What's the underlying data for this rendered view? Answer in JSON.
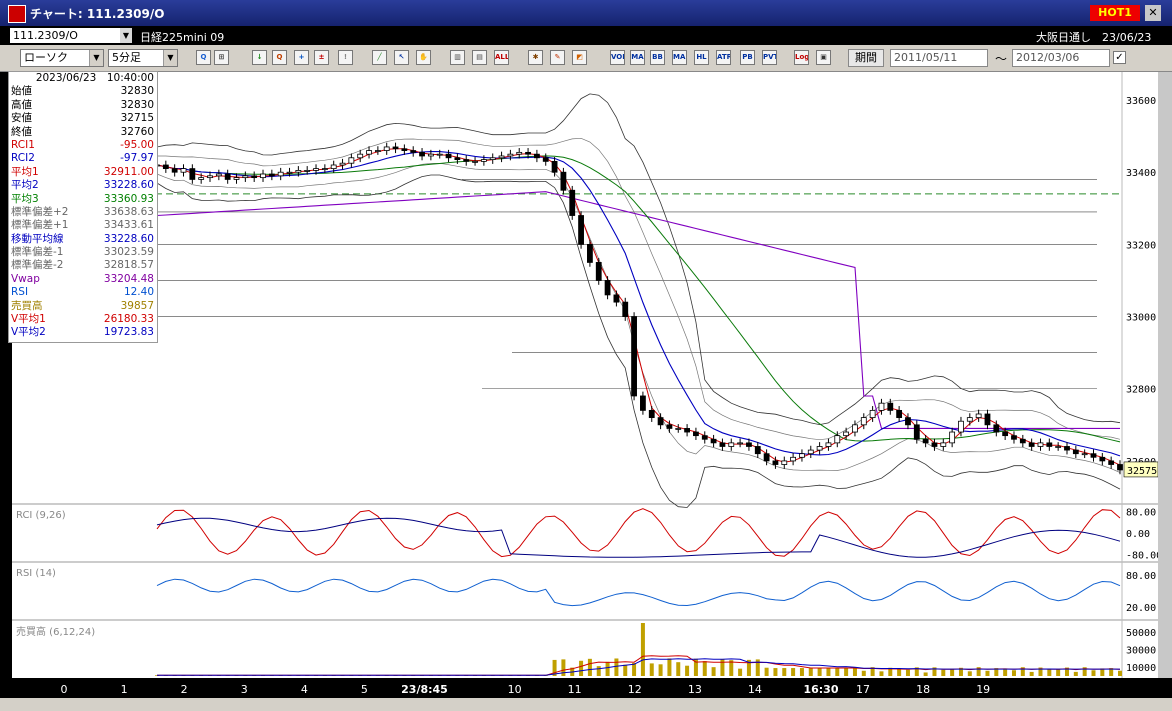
{
  "window": {
    "title": "チャート: 111.2309/O",
    "hot_label": "HOT1",
    "close_label": "✕"
  },
  "symbol_bar": {
    "symbol": "111.2309/O",
    "instrument_name": "日経225mini 09",
    "market_info": "大阪日通し　23/06/23"
  },
  "toolbar": {
    "chart_type": "ローソク",
    "interval": "5分足",
    "icon_buttons": [
      {
        "name": "zoom-icon",
        "label": "Q",
        "color": "#1a5fd0"
      },
      {
        "name": "grid-icon",
        "label": "⊞",
        "color": "#444"
      },
      {
        "name": "arrow-down-icon",
        "label": "↓",
        "color": "#1a8a1a"
      },
      {
        "name": "magnify-icon",
        "label": "Q",
        "color": "#c04000"
      },
      {
        "name": "crosshair-icon",
        "label": "+",
        "color": "#0050c0"
      },
      {
        "name": "compare-icon",
        "label": "±",
        "color": "#c00000"
      },
      {
        "name": "warning-icon",
        "label": "!",
        "color": "#888"
      },
      {
        "name": "trendline-icon",
        "label": "╱",
        "color": "#2a8a2a"
      },
      {
        "name": "pointer-icon",
        "label": "↖",
        "color": "#0030a0"
      },
      {
        "name": "hand-icon",
        "label": "✋",
        "color": "#0060c0"
      },
      {
        "name": "bars-icon",
        "label": "▥",
        "color": "#444"
      },
      {
        "name": "bars2-icon",
        "label": "▤",
        "color": "#444"
      },
      {
        "name": "all-icon",
        "label": "ALL",
        "color": "#c00000"
      },
      {
        "name": "settings-icon",
        "label": "✱",
        "color": "#804000"
      },
      {
        "name": "brush-icon",
        "label": "✎",
        "color": "#c03000"
      },
      {
        "name": "color-icon",
        "label": "◩",
        "color": "#d06000"
      },
      {
        "name": "volume-icon",
        "label": "VOL",
        "color": "#0030a0"
      },
      {
        "name": "ma-icon",
        "label": "MA",
        "color": "#0030a0"
      },
      {
        "name": "bb-icon",
        "label": "BB",
        "color": "#0030a0"
      },
      {
        "name": "mae-icon",
        "label": "MAE",
        "color": "#0030a0"
      },
      {
        "name": "hl-icon",
        "label": "HL",
        "color": "#0030a0"
      },
      {
        "name": "atr-icon",
        "label": "ATR",
        "color": "#0030a0"
      },
      {
        "name": "pb-icon",
        "label": "PB",
        "color": "#0030a0"
      },
      {
        "name": "pvt-icon",
        "label": "PVT",
        "color": "#0030a0"
      },
      {
        "name": "log-icon",
        "label": "Log",
        "color": "#c00000"
      },
      {
        "name": "print-icon",
        "label": "▣",
        "color": "#333"
      }
    ],
    "period_label": "期間",
    "date_from": "2011/05/11",
    "date_to": "2012/03/06",
    "tilde": "～",
    "check": "✓"
  },
  "info_panel": {
    "datetime": "2023/06/23　10:40:00",
    "rows": [
      {
        "label": "始値",
        "value": "32830",
        "color": "#000000"
      },
      {
        "label": "高値",
        "value": "32830",
        "color": "#000000"
      },
      {
        "label": "安値",
        "value": "32715",
        "color": "#000000"
      },
      {
        "label": "終値",
        "value": "32760",
        "color": "#000000"
      },
      {
        "label": "RCI1",
        "value": "-95.00",
        "color": "#d00000"
      },
      {
        "label": "RCI2",
        "value": "-97.97",
        "color": "#0000c0"
      },
      {
        "label": "平均1",
        "value": "32911.00",
        "color": "#d00000"
      },
      {
        "label": "平均2",
        "value": "33228.60",
        "color": "#0000c0"
      },
      {
        "label": "平均3",
        "value": "33360.93",
        "color": "#008000"
      },
      {
        "label": "標準偏差+2",
        "value": "33638.63",
        "color": "#666666"
      },
      {
        "label": "標準偏差+1",
        "value": "33433.61",
        "color": "#666666"
      },
      {
        "label": "移動平均線",
        "value": "33228.60",
        "color": "#0000c0"
      },
      {
        "label": "標準偏差-1",
        "value": "33023.59",
        "color": "#666666"
      },
      {
        "label": "標準偏差-2",
        "value": "32818.57",
        "color": "#666666"
      },
      {
        "label": "Vwap",
        "value": "33204.48",
        "color": "#8000a0"
      },
      {
        "label": "RSI",
        "value": "12.40",
        "color": "#0050d0"
      },
      {
        "label": "売買高",
        "value": "39857",
        "color": "#a08000"
      },
      {
        "label": "V平均1",
        "value": "26180.33",
        "color": "#d00000"
      },
      {
        "label": "V平均2",
        "value": "19723.83",
        "color": "#0000c0"
      }
    ]
  },
  "chart_data": {
    "type": "candlestick",
    "price_axis": {
      "min": 32500,
      "max": 33650,
      "ticks": [
        "33600",
        "33400",
        "33200",
        "33000",
        "32800",
        "32600"
      ],
      "last_price": "32575"
    },
    "reference_line": 33340,
    "x_ticks": [
      {
        "label": "0",
        "idx": 3
      },
      {
        "label": "1",
        "idx": 13
      },
      {
        "label": "2",
        "idx": 23
      },
      {
        "label": "3",
        "idx": 33
      },
      {
        "label": "4",
        "idx": 43
      },
      {
        "label": "5",
        "idx": 53
      },
      {
        "label": "23/8:45",
        "idx": 63,
        "bold": true
      },
      {
        "label": "10",
        "idx": 78
      },
      {
        "label": "11",
        "idx": 88
      },
      {
        "label": "12",
        "idx": 98
      },
      {
        "label": "13",
        "idx": 108
      },
      {
        "label": "14",
        "idx": 118
      },
      {
        "label": "16:30",
        "idx": 129,
        "bold": true
      },
      {
        "label": "17",
        "idx": 136
      },
      {
        "label": "18",
        "idx": 146
      },
      {
        "label": "19",
        "idx": 156
      }
    ],
    "closes": [
      33420,
      33410,
      33400,
      33410,
      33380,
      33385,
      33390,
      33395,
      33380,
      33385,
      33390,
      33385,
      33395,
      33390,
      33400,
      33400,
      33405,
      33405,
      33410,
      33410,
      33420,
      33425,
      33440,
      33450,
      33460,
      33460,
      33470,
      33465,
      33460,
      33455,
      33445,
      33450,
      33450,
      33440,
      33435,
      33430,
      33430,
      33435,
      33440,
      33445,
      33450,
      33455,
      33450,
      33440,
      33430,
      33400,
      33350,
      33280,
      33200,
      33150,
      33100,
      33060,
      33040,
      33000,
      32780,
      32740,
      32720,
      32700,
      32690,
      32690,
      32680,
      32670,
      32660,
      32650,
      32640,
      32650,
      32650,
      32640,
      32620,
      32600,
      32590,
      32600,
      32610,
      32620,
      32630,
      32640,
      32650,
      32670,
      32680,
      32700,
      32720,
      32740,
      32760,
      32740,
      32720,
      32700,
      32660,
      32650,
      32640,
      32650,
      32680,
      32710,
      32720,
      32730,
      32700,
      32680,
      32670,
      32660,
      32650,
      32640,
      32650,
      32640,
      32640,
      32630,
      32620,
      32620,
      32610,
      32600,
      32590,
      32575
    ],
    "rci": {
      "ticks": [
        "80.00",
        "0.00",
        "-80.00"
      ],
      "label": "RCI (9,26)"
    },
    "rsi": {
      "ticks": [
        "80.00",
        "20.00"
      ],
      "label": "RSI (14)"
    },
    "volume": {
      "ticks": [
        "50000",
        "30000",
        "10000"
      ],
      "label": "売買高 (6,12,24)"
    }
  }
}
